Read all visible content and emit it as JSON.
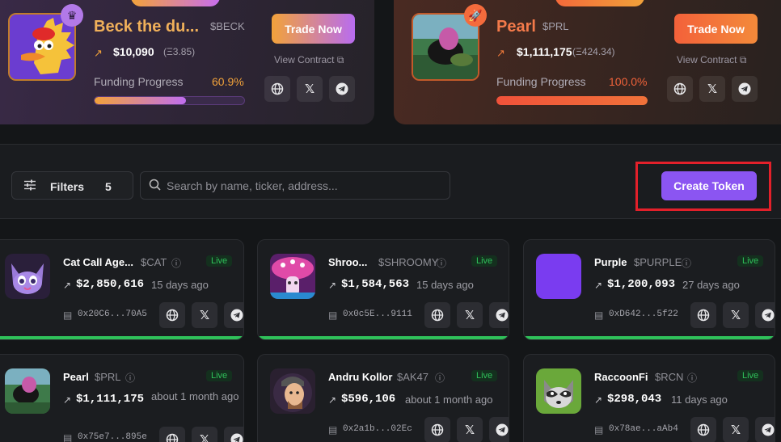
{
  "featured": [
    {
      "name": "Beck the du...",
      "ticker": "$BECK",
      "price": "$10,090",
      "eth": "(Ξ3.85)",
      "funding_label": "Funding Progress",
      "funding_pct": "60.9%",
      "progress": 0.609,
      "trade_label": "Trade Now",
      "view_contract": "View Contract",
      "corner_icon": "crown-icon"
    },
    {
      "name": "Pearl",
      "ticker": "$PRL",
      "price": "$1,111,175",
      "eth": "(Ξ424.34)",
      "funding_label": "Funding Progress",
      "funding_pct": "100.0%",
      "progress": 1.0,
      "trade_label": "Trade Now",
      "view_contract": "View Contract",
      "corner_icon": "rocket-icon"
    }
  ],
  "toolbar": {
    "filters_label": "Filters",
    "filters_count": "5",
    "search_placeholder": "Search by name, ticker, address...",
    "create_label": "Create Token"
  },
  "tokens": [
    {
      "name": "Cat Call Age...",
      "ticker": "$CAT",
      "status": "Live",
      "mcap": "$2,850,616",
      "age": "15 days ago",
      "address": "0x20C6...70A5"
    },
    {
      "name": "Shroo...",
      "ticker": "$SHROOMY",
      "status": "Live",
      "mcap": "$1,584,563",
      "age": "15 days ago",
      "address": "0x0c5E...9111"
    },
    {
      "name": "Purple",
      "ticker": "$PURPLE",
      "status": "Live",
      "mcap": "$1,200,093",
      "age": "27 days ago",
      "address": "0xD642...5f22"
    },
    {
      "name": "Pearl",
      "ticker": "$PRL",
      "status": "Live",
      "mcap": "$1,111,175",
      "age": "about 1 month ago",
      "address": "0x75e7...895e"
    },
    {
      "name": "Andru Kollor",
      "ticker": "$AK47",
      "status": "Live",
      "mcap": "$596,106",
      "age": "about 1 month ago",
      "address": "0x2a1b...02Ec"
    },
    {
      "name": "RaccoonFi",
      "ticker": "$RCN",
      "status": "Live",
      "mcap": "$298,043",
      "age": "11 days ago",
      "address": "0x78ae...aAb4"
    }
  ],
  "colors": {
    "accent": "#8b55f2",
    "live": "#2fc15a",
    "highlight": "#e3202a"
  }
}
